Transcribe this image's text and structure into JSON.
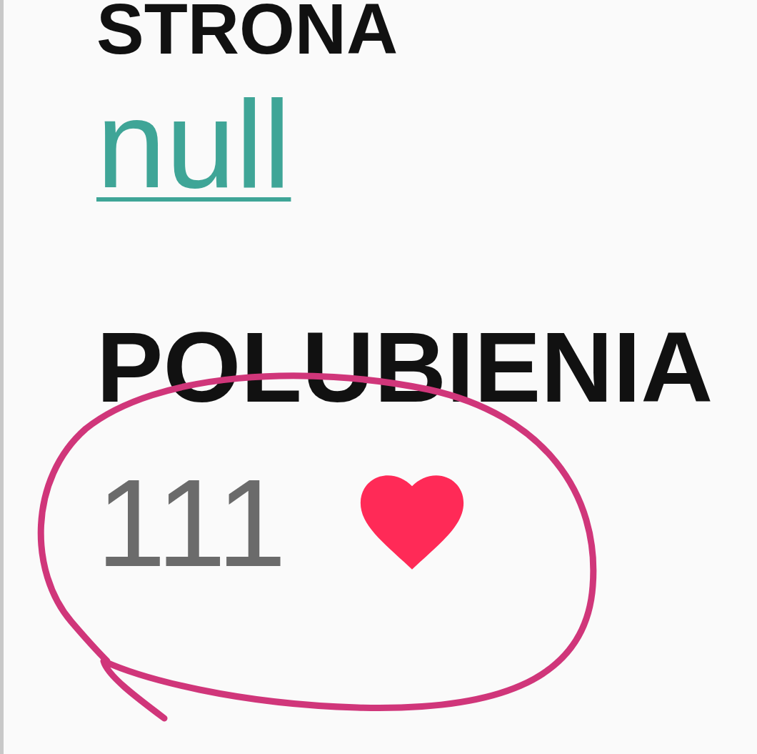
{
  "sections": [
    {
      "heading": "STRONA",
      "kind": "link",
      "value": "null"
    },
    {
      "heading": "POLUBIENIA",
      "kind": "likes",
      "value": "111"
    }
  ],
  "annotation": {
    "kind": "circle"
  }
}
